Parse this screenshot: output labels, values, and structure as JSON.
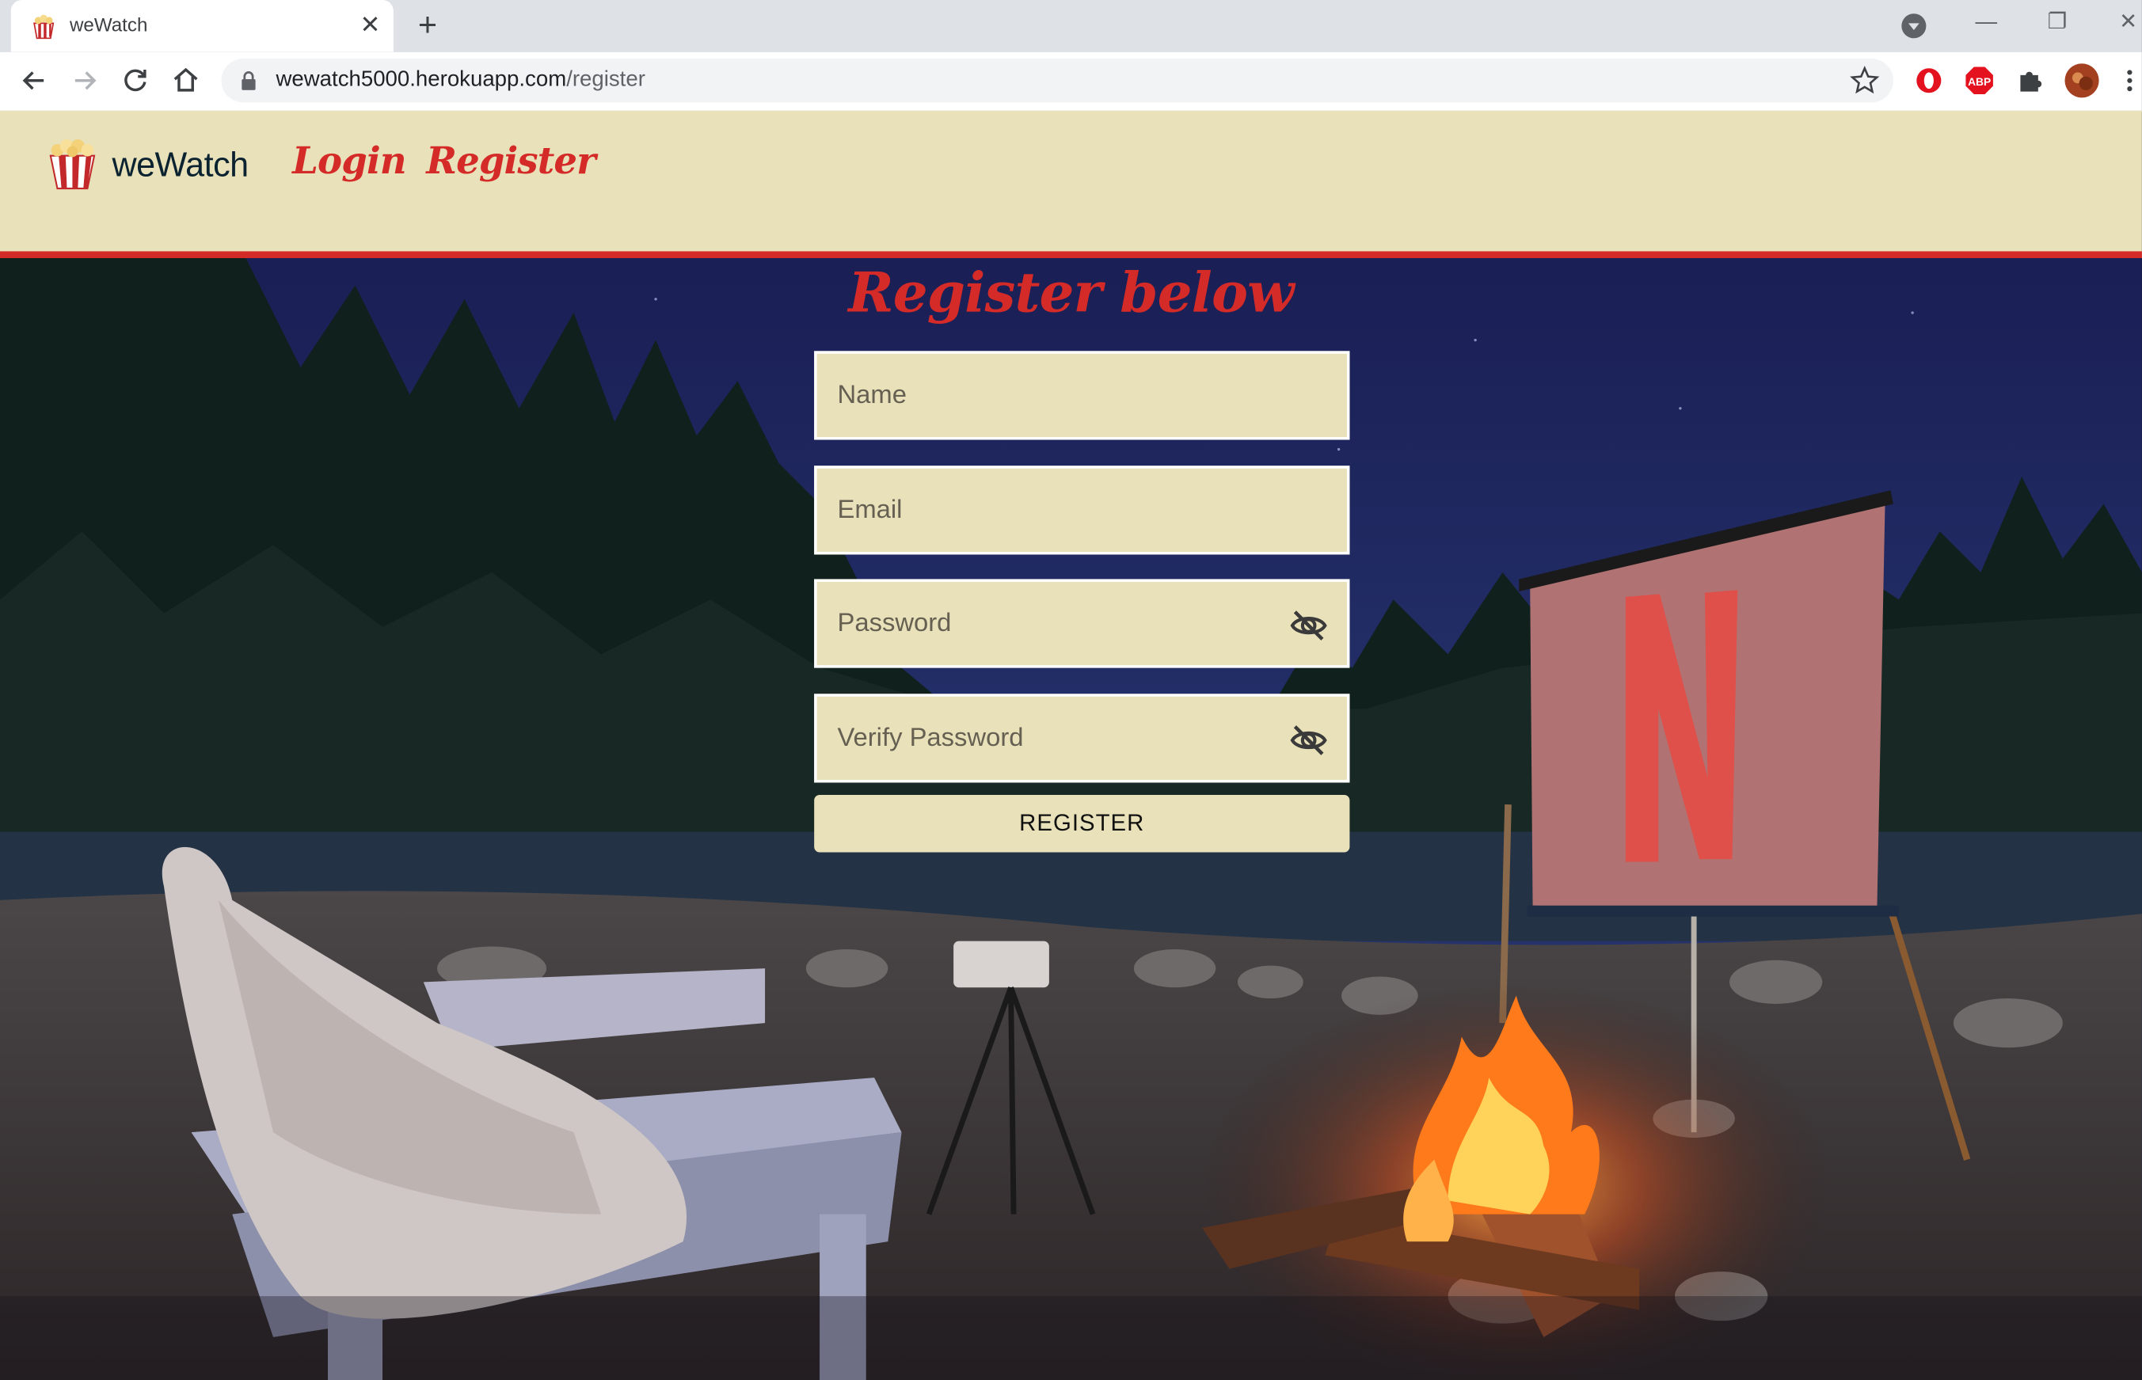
{
  "browser": {
    "tab_title": "weWatch",
    "tab_close": "✕",
    "new_tab": "+",
    "url_host": "wewatch5000.herokuapp.com",
    "url_path": "/register",
    "window_minimize": "—",
    "window_restore": "❐",
    "window_close": "✕"
  },
  "navbar": {
    "brand": "weWatch",
    "links": [
      {
        "label": "Login"
      },
      {
        "label": "Register"
      }
    ]
  },
  "form": {
    "heading": "Register below",
    "fields": {
      "name": {
        "placeholder": "Name",
        "value": ""
      },
      "email": {
        "placeholder": "Email",
        "value": ""
      },
      "password": {
        "placeholder": "Password",
        "value": ""
      },
      "verify_password": {
        "placeholder": "Verify Password",
        "value": ""
      }
    },
    "submit_label": "REGISTER"
  },
  "colors": {
    "accent_red": "#d42a28",
    "cream": "#e8e1b9",
    "dark_navy": "#0b2230"
  },
  "icons": {
    "favicon": "popcorn-icon",
    "password_toggle": "eye-slash-icon",
    "extensions": [
      "opera-icon",
      "adblock-plus-icon",
      "puzzle-extensions-icon",
      "profile-avatar"
    ]
  }
}
